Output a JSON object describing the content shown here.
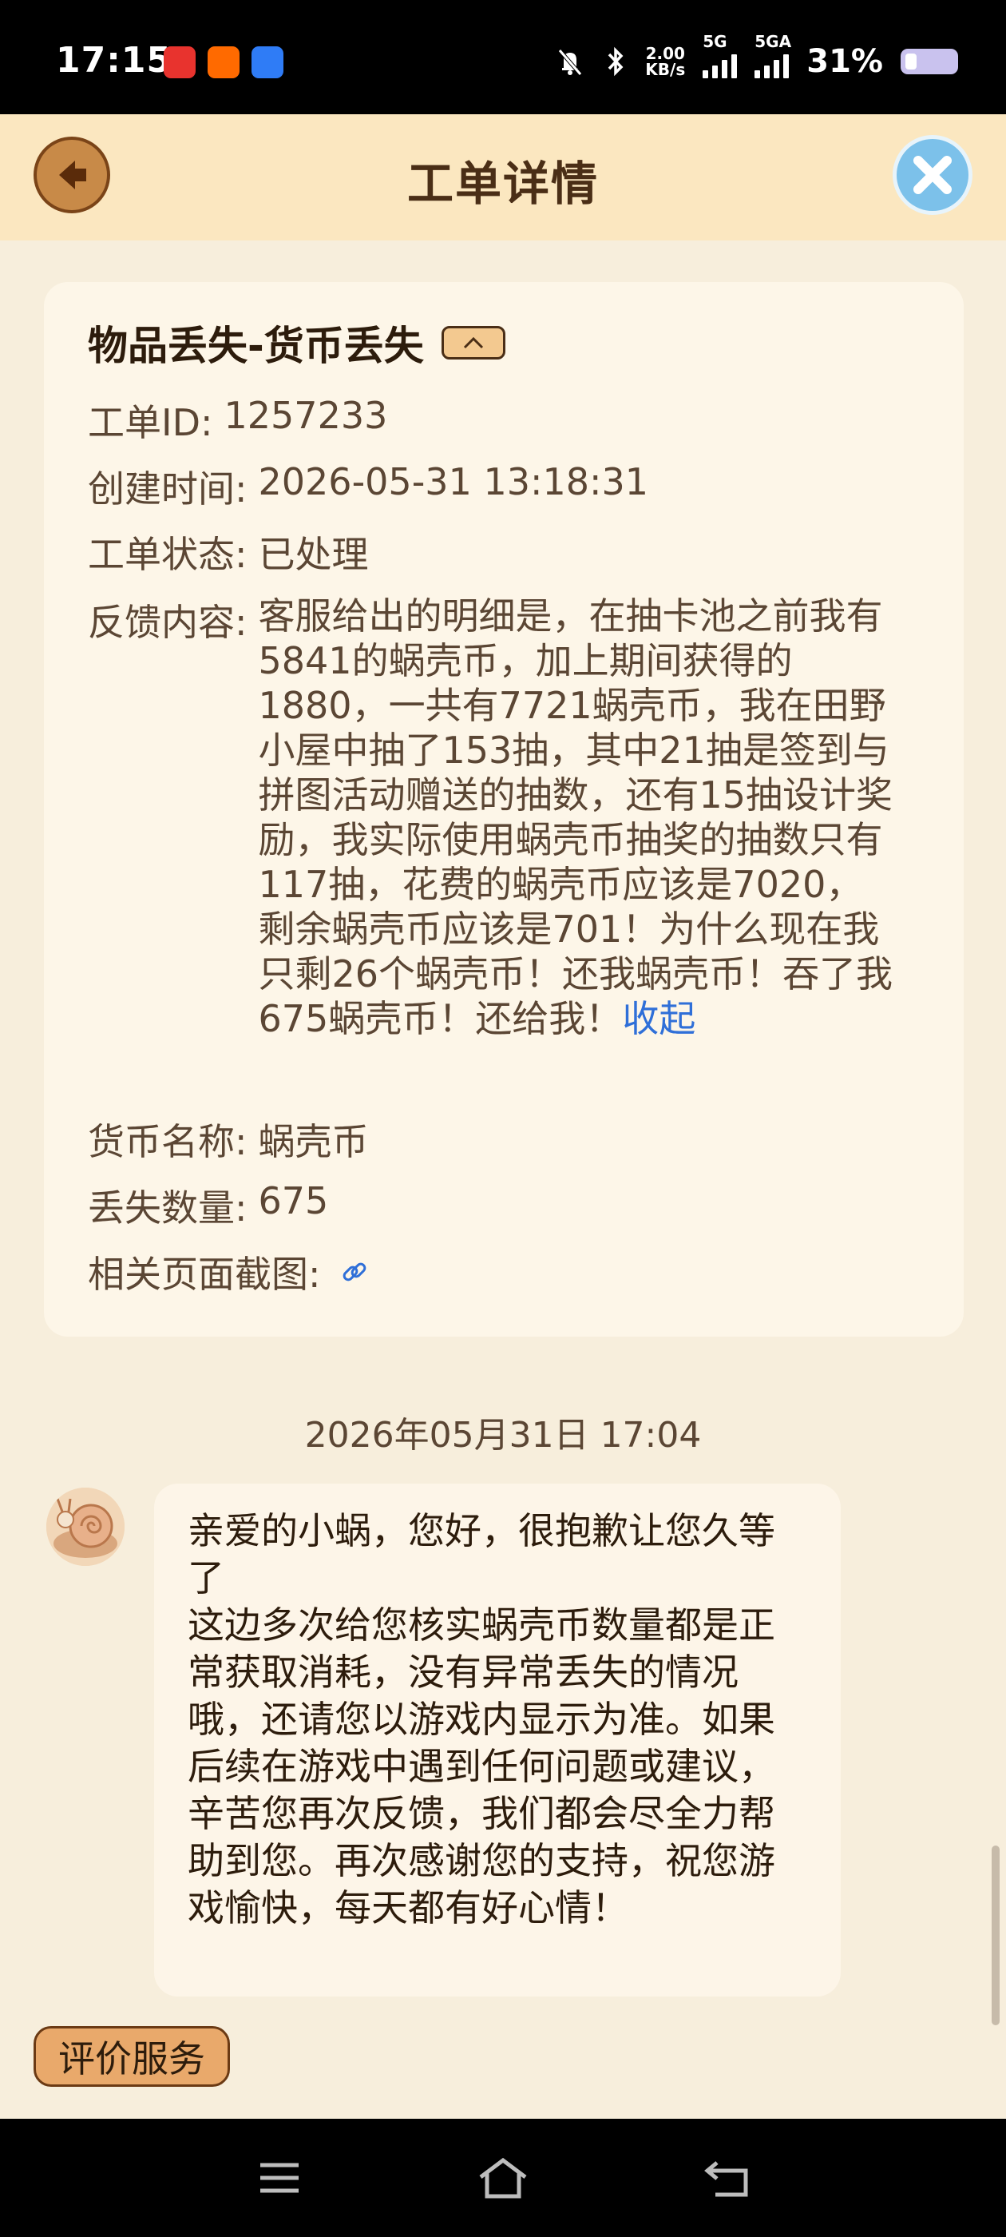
{
  "status_bar": {
    "time": "17:15",
    "apps": [
      "小红书",
      "淘",
      "du"
    ],
    "net_speed_value": "2.00",
    "net_speed_unit": "KB/s",
    "signal1": "5G",
    "signal2": "5GA",
    "battery_percent": "31%"
  },
  "header": {
    "title": "工单详情",
    "back_icon": "back-arrow-icon",
    "close_icon": "close-icon"
  },
  "ticket": {
    "title": "物品丢失-货币丢失",
    "id_label": "工单ID:",
    "id_value": "1257233",
    "created_label": "创建时间:",
    "created_value": "2026-05-31 13:18:31",
    "status_label": "工单状态:",
    "status_value": "已处理",
    "feedback_label": "反馈内容:",
    "feedback_value": "客服给出的明细是，在抽卡池之前我有5841的蜗壳币，加上期间获得的1880，一共有7721蜗壳币，我在田野小屋中抽了153抽，其中21抽是签到与拼图活动赠送的抽数，还有15抽设计奖励，我实际使用蜗壳币抽奖的抽数只有117抽，花费的蜗壳币应该是7020，剩余蜗壳币应该是701！为什么现在我只剩26个蜗壳币！还我蜗壳币！吞了我675蜗壳币！还给我！",
    "collapse_link": "收起",
    "currency_label": "货币名称:",
    "currency_value": "蜗壳币",
    "lost_label": "丢失数量:",
    "lost_value": "675",
    "screenshot_label": "相关页面截图:"
  },
  "chat": {
    "date": "2026年05月31日 17:04",
    "message": "亲爱的小蜗，您好，很抱歉让您久等了\n这边多次给您核实蜗壳币数量都是正常获取消耗，没有异常丢失的情况哦，还请您以游戏内显示为准。如果后续在游戏中遇到任何问题或建议，辛苦您再次反馈，我们都会尽全力帮助到您。再次感谢您的支持，祝您游戏愉快，每天都有好心情！"
  },
  "rate_button": "评价服务",
  "colors": {
    "background": "#f7eedc",
    "header": "#fbe7c0",
    "card": "#fdf6e8",
    "link": "#2f6fd8",
    "accent_button": "#e9a96b"
  }
}
